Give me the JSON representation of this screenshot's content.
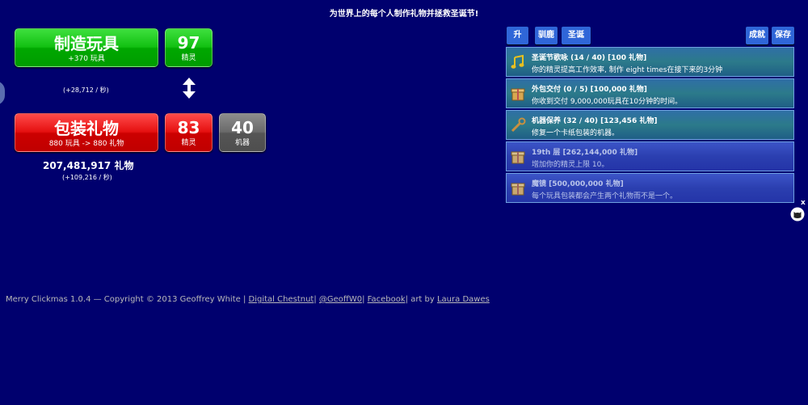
{
  "headline": "为世界上的每个人制作礼物并拯救圣诞节!",
  "make_toys": {
    "label": "制造玩具",
    "sub": "+370 玩具"
  },
  "elves_make": {
    "count": "97",
    "label": "精灵"
  },
  "toy_rate": "(+28,712 / 秒)",
  "wrap": {
    "label": "包装礼物",
    "sub": "880 玩具 -> 880 礼物"
  },
  "elves_wrap": {
    "count": "83",
    "label": "精灵"
  },
  "machines": {
    "count": "40",
    "label": "机器"
  },
  "gifts_total": "207,481,917 礼物",
  "gift_rate": "(+109,216 / 秒)",
  "tabs": {
    "upgrade": "升级",
    "reindeer": "驯鹿",
    "tree": "圣诞树",
    "achievements": "成就",
    "save": "保存"
  },
  "upgrades": [
    {
      "title": "圣诞节歌咏 (14 / 40) [100 礼物]",
      "desc": "你的精灵提高工作效率, 制作 eight times在接下来的3分钟",
      "icon": "music-note-icon"
    },
    {
      "title": "外包交付 (0 / 5) [100,000 礼物]",
      "desc": "你收到交付 9,000,000玩具在10分钟的时间。",
      "icon": "gift-box-icon"
    },
    {
      "title": "机器保养 (32 / 40) [123,456 礼物]",
      "desc": "修复一个卡纸包装的机器。",
      "icon": "wrench-icon"
    },
    {
      "title": "19th 层 [262,144,000 礼物]",
      "desc": "增加你的精灵上限 10。",
      "icon": "gift-box-icon"
    },
    {
      "title": "魔镜 [500,000,000 礼物]",
      "desc": "每个玩具包装都会产生两个礼物而不是一个。",
      "icon": "gift-box-icon"
    }
  ],
  "footer": {
    "prefix": "Merry Clickmas 1.0.4 — Copyright © 2013 Geoffrey White |",
    "link1": "Digital Chestnut",
    "sep1": "|",
    "link2": "@GeoffW0",
    "sep2": "|",
    "link3": "Facebook",
    "mid": "| art by",
    "link4": "Laura Dawes"
  },
  "side_close": "x"
}
